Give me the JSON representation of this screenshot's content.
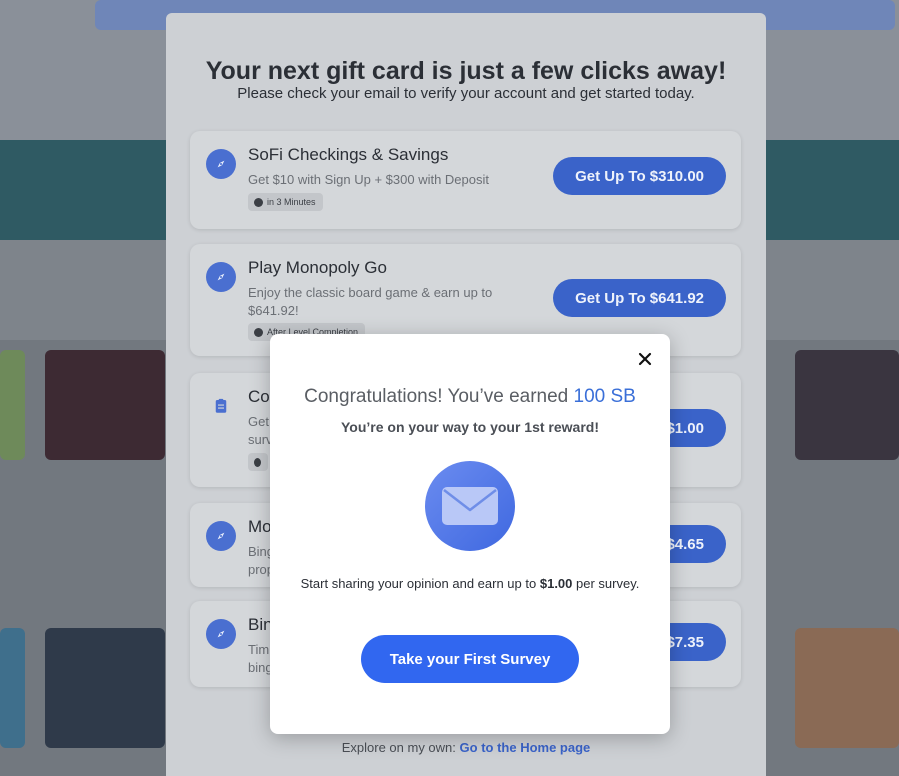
{
  "outer": {
    "title": "Your next gift card is just a few clicks away!",
    "subtitle": "Please check your email to verify your account and get started today.",
    "offers": [
      {
        "name": "SoFi Checkings & Savings",
        "desc": "Get $10 with Sign Up + $300 with Deposit",
        "tag": "in 3 Minutes",
        "button": "Get Up To $310.00",
        "icon": "compass-icon"
      },
      {
        "name": "Play Monopoly Go",
        "desc": "Enjoy the classic board game & earn up to $641.92!",
        "tag": "After Level Completion",
        "button": "Get Up To $641.92",
        "icon": "compass-icon"
      },
      {
        "name": "Co",
        "desc": "Get\nsurv",
        "tag": "",
        "button": "$1.00",
        "icon": "clipboard-icon"
      },
      {
        "name": "Mo",
        "desc": "Bing\nprop",
        "tag": "",
        "button": "$4.65",
        "icon": "compass-icon"
      },
      {
        "name": "Bin",
        "desc": "Tim\nbing",
        "tag": "",
        "button": "$7.35",
        "icon": "compass-icon"
      }
    ],
    "footer_prefix": "Explore on my own:",
    "footer_link": "Go to the Home page"
  },
  "popup": {
    "congrats_prefix": "Congratulations! You’ve earned",
    "congrats_amount": "100 SB",
    "subtitle": "You’re on your way to your 1st reward!",
    "share_prefix": "Start sharing your opinion and earn up to",
    "share_amount": "$1.00",
    "share_suffix": "per survey.",
    "cta": "Take your First Survey",
    "icon": "mail-icon"
  },
  "colors": {
    "accent": "#3167f0",
    "amount": "#3a6fd8"
  }
}
